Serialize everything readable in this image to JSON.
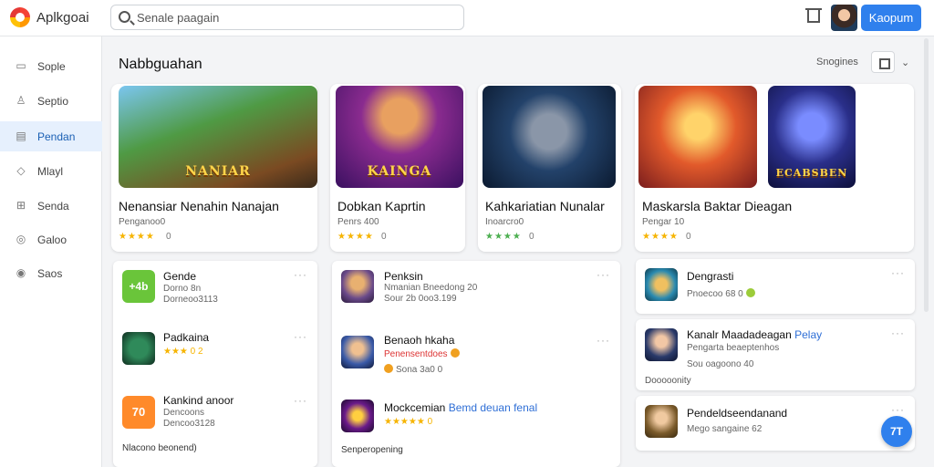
{
  "app": {
    "name": "Aplkgoai"
  },
  "search": {
    "placeholder": "Senale paagain"
  },
  "header": {
    "primary_button": "Kaopum"
  },
  "sidebar": {
    "items": [
      {
        "label": "Sople",
        "icon": "square-icon"
      },
      {
        "label": "Septio",
        "icon": "user-icon"
      },
      {
        "label": "Pendan",
        "icon": "grid-icon"
      },
      {
        "label": "Mlayl",
        "icon": "tag-icon"
      },
      {
        "label": "Senda",
        "icon": "plus-square-icon"
      },
      {
        "label": "Galoo",
        "icon": "globe-icon"
      },
      {
        "label": "Saos",
        "icon": "info-icon"
      }
    ]
  },
  "main": {
    "title": "Nabbguahan",
    "sort_label": "Snogines",
    "featured": [
      {
        "title": "Nenansiar Nenahin Nanajan",
        "sub": "Penganoo0",
        "stars": "★★★★",
        "rating": "0",
        "img_text": "NANIAR"
      },
      {
        "title": "Dobkan Kaprtin",
        "sub": "Penrs 400",
        "stars": "★★★★",
        "rating": "0",
        "img_text": "KAINGA"
      },
      {
        "title": "Kahkariatian Nunalar",
        "sub": "Inoarcro0",
        "stars": "★★★★",
        "rating": "0",
        "img_text": ""
      },
      {
        "title": "Maskarsla Baktar Dieagan",
        "sub": "Pengar 10",
        "stars": "★★★★",
        "rating": "0",
        "img_text": "ECABSBEN"
      }
    ],
    "list_left": [
      {
        "title": "Gende",
        "sub": "Dorno 8n",
        "sub2": "Dorneoo3113",
        "icon_text": "+4b"
      },
      {
        "title": "Padkaina",
        "sub": "★★★ 0 2",
        "sub2": "",
        "icon_text": ""
      },
      {
        "title": "Kankind anoor",
        "sub": "Dencoons",
        "sub2": "Dencoo3128",
        "icon_text": "70"
      }
    ],
    "list_left_footer": "Nlacono beonend)",
    "list_mid": [
      {
        "title": "Penksin",
        "sub": "Nmanian Bneedong 20",
        "sub2": "Sour 2b 0oo3.199"
      },
      {
        "title": "Benaoh hkaha",
        "sub": "Penensentdoes",
        "sub2": "Sona 3a0 0"
      },
      {
        "title": "Mockcemian",
        "title_accent": "Bemd deuan fenal",
        "sub": "★★★★★ 0",
        "sub2": ""
      }
    ],
    "list_mid_footer": "Senperopening",
    "list_right": [
      {
        "title": "Dengrasti",
        "title_accent": "",
        "sub": "Pnoecoo 68 0",
        "sub2": ""
      },
      {
        "title": "Kanalr Maadadeagan",
        "title_accent": "Pelay",
        "sub": "Pengarta beaeptenhos",
        "sub2": "Sou oagoono 40"
      },
      {
        "title": "Pendeldseendanand",
        "title_accent": "",
        "sub": "Mego sangaine 62",
        "sub2": ""
      }
    ],
    "list_right_middle_note": "Dooooonity",
    "fab_label": "7T"
  }
}
